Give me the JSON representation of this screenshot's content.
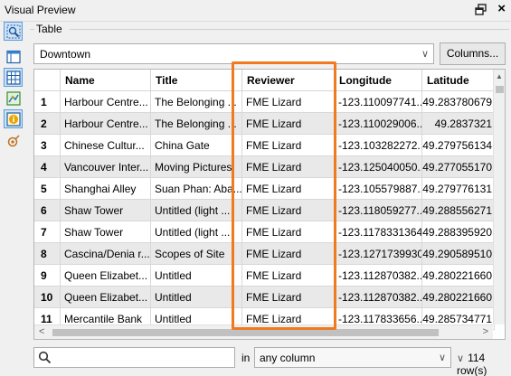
{
  "window": {
    "title": "Visual Preview"
  },
  "group_label": "Table",
  "table_selector": {
    "value": "Downtown"
  },
  "columns_button": "Columns...",
  "columns": [
    "",
    "Name",
    "Title",
    "Reviewer",
    "Longitude",
    "Latitude"
  ],
  "rows": [
    {
      "num": "1",
      "name": "Harbour Centre...",
      "title": "The Belonging ...",
      "reviewer": "FME Lizard",
      "longitude": "-123.110097741...",
      "latitude": "49.283780679"
    },
    {
      "num": "2",
      "name": "Harbour Centre...",
      "title": "The Belonging ...",
      "reviewer": "FME Lizard",
      "longitude": "-123.110029006...",
      "latitude": "49.2837321"
    },
    {
      "num": "3",
      "name": "Chinese Cultur...",
      "title": "China Gate",
      "reviewer": "FME Lizard",
      "longitude": "-123.103282272...",
      "latitude": "49.279756134"
    },
    {
      "num": "4",
      "name": "Vancouver Inter...",
      "title": "Moving Pictures",
      "reviewer": "FME Lizard",
      "longitude": "-123.125040050...",
      "latitude": "49.277055170"
    },
    {
      "num": "5",
      "name": "Shanghai Alley",
      "title": "Suan Phan: Aba...",
      "reviewer": "FME Lizard",
      "longitude": "-123.105579887...",
      "latitude": "49.279776131"
    },
    {
      "num": "6",
      "name": "Shaw Tower",
      "title": "Untitled (light ...",
      "reviewer": "FME Lizard",
      "longitude": "-123.118059277...",
      "latitude": "49.288556271"
    },
    {
      "num": "7",
      "name": "Shaw Tower",
      "title": "Untitled (light ...",
      "reviewer": "FME Lizard",
      "longitude": "-123.11783313642",
      "latitude": "49.288395920"
    },
    {
      "num": "8",
      "name": "Cascina/Denia r...",
      "title": "Scopes of Site",
      "reviewer": "FME Lizard",
      "longitude": "-123.12717399301",
      "latitude": "49.290589510"
    },
    {
      "num": "9",
      "name": "Queen Elizabet...",
      "title": "Untitled",
      "reviewer": "FME Lizard",
      "longitude": "-123.112870382...",
      "latitude": "49.280221660"
    },
    {
      "num": "10",
      "name": "Queen Elizabet...",
      "title": "Untitled",
      "reviewer": "FME Lizard",
      "longitude": "-123.112870382...",
      "latitude": "49.280221660"
    },
    {
      "num": "11",
      "name": "Mercantile Bank",
      "title": "Untitled",
      "reviewer": "FME Lizard",
      "longitude": "-123.117833656...",
      "latitude": "49.285734771"
    }
  ],
  "search": {
    "value": "",
    "in_label": "in",
    "scope": "any column"
  },
  "row_count": "114 row(s)",
  "colors": {
    "highlight": "#f07a1f",
    "active_tool": "#cfe3f7",
    "alt_row": "#e9e9e9"
  },
  "toolbar_icons": [
    "zoom-extents-icon",
    "table-view-icon",
    "grid-view-icon",
    "graphics-view-icon",
    "information-icon",
    "record-selection-icon"
  ]
}
